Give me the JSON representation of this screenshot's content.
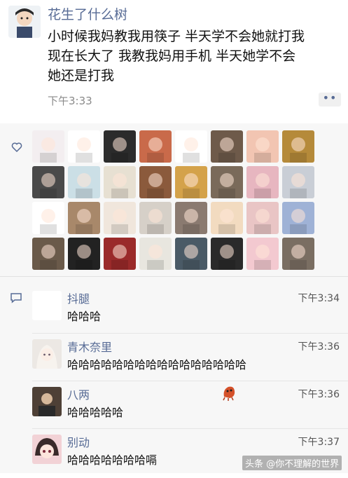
{
  "post": {
    "author": "花生了什么树",
    "text_lines": [
      "小时候我妈教我用筷子 半天学不会她就打我",
      "现在长大了 我教我妈用手机 半天她学不会",
      "她还是打我"
    ],
    "time": "下午3:33",
    "more_label": "••"
  },
  "likes": {
    "icon": "heart-outline-icon",
    "avatar_colors": [
      "#f3eef0",
      "#ffffff",
      "#2b2b2b",
      "#c96a4a",
      "#ffffff",
      "#6e5a4a",
      "#f2c5b2",
      "#b58a3a",
      "#4a4a4a",
      "#cbdfe6",
      "#e7e0d2",
      "#8b5a3c",
      "#d4a24a",
      "#7a6a5a",
      "#e7b6c0",
      "#c9ced6",
      "#ffffff",
      "#a8886a",
      "#f0e6dc",
      "#d6d0c8",
      "#8a7a70",
      "#f2dbc0",
      "#e9c5c5",
      "#9fb2d6",
      "#6a5a4a",
      "#222222",
      "#9a2a2a",
      "#e8e6df",
      "#4a5a66",
      "#2a2a2a",
      "#f3c9d0",
      "#7a6e62"
    ]
  },
  "comments": {
    "icon": "comment-bubble-icon",
    "items": [
      {
        "name": "抖腿",
        "time": "下午3:34",
        "text": "哈哈哈",
        "avatar_color": "#ffffff"
      },
      {
        "name": "青木奈里",
        "time": "下午3:36",
        "text": "哈哈哈哈哈哈哈哈哈哈哈哈哈哈哈哈",
        "avatar_color": "#ece8e4"
      },
      {
        "name": "八两",
        "time": "下午3:36",
        "text": "哈哈哈哈哈",
        "avatar_color": "#5a4a3e"
      },
      {
        "name": "别动",
        "time": "下午3:37",
        "text": "哈哈哈哈哈哈哈嗝",
        "avatar_color": "#e6b0b8"
      }
    ]
  },
  "watermark": "头条 @你不理解的世界"
}
